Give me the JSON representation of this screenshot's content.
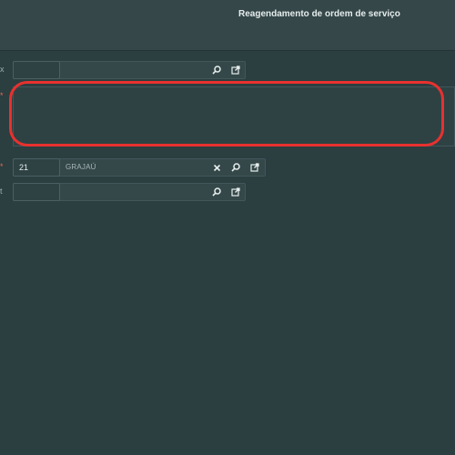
{
  "header": {
    "title": "Reagendamento de ordem de serviço"
  },
  "fields": {
    "row1": {
      "label": "x",
      "code": "",
      "description": ""
    },
    "row2": {
      "label": "*"
    },
    "row3": {
      "label": "*",
      "code": "21",
      "description": "GRAJAÚ"
    },
    "row4": {
      "label": "t",
      "code": "",
      "description": ""
    }
  },
  "icons": {
    "search": "⚲",
    "open": "⧉",
    "clear": "✕"
  }
}
